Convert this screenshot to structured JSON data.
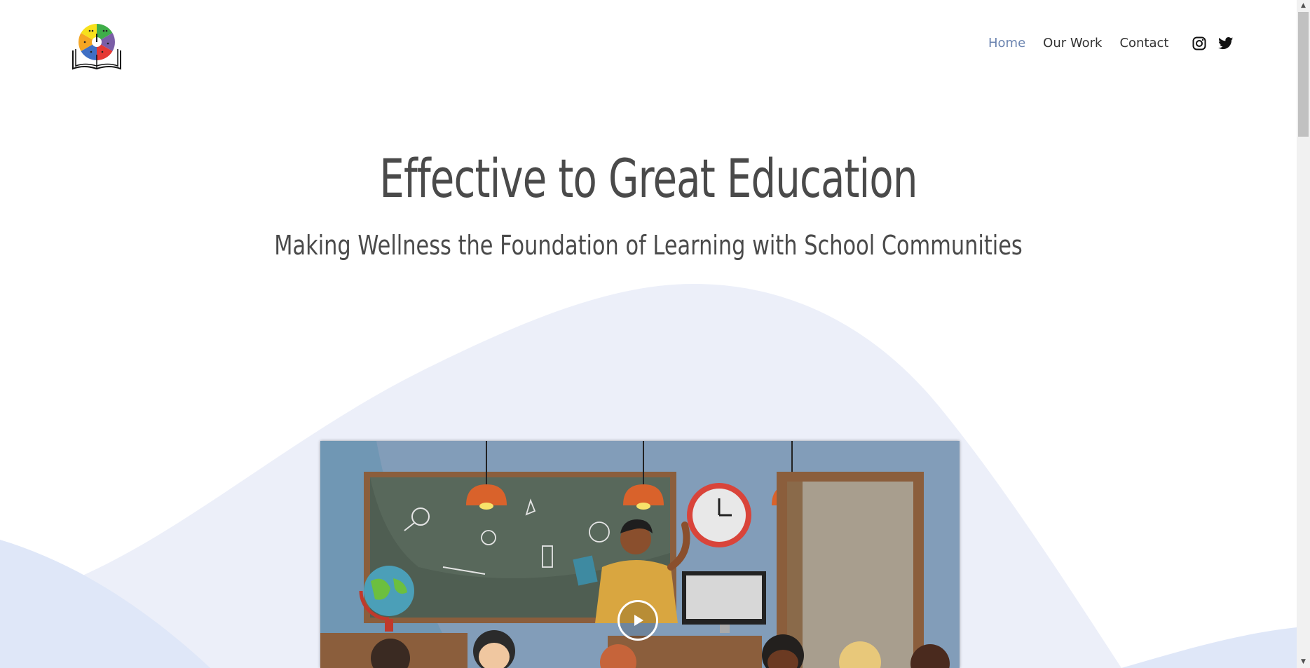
{
  "nav": {
    "items": [
      {
        "label": "Home",
        "active": true
      },
      {
        "label": "Our Work",
        "active": false
      },
      {
        "label": "Contact",
        "active": false
      }
    ],
    "social": [
      "instagram-icon",
      "twitter-icon"
    ]
  },
  "hero": {
    "title": "Effective to Great Education",
    "subtitle": "Making Wellness the Foundation of Learning with School Communities"
  },
  "video": {
    "play_icon": "play-icon"
  },
  "colors": {
    "accent": "#6b84b0",
    "text": "#4a4a4a",
    "wave_light": "#eceff9",
    "wave_blue": "#dce6f8"
  }
}
